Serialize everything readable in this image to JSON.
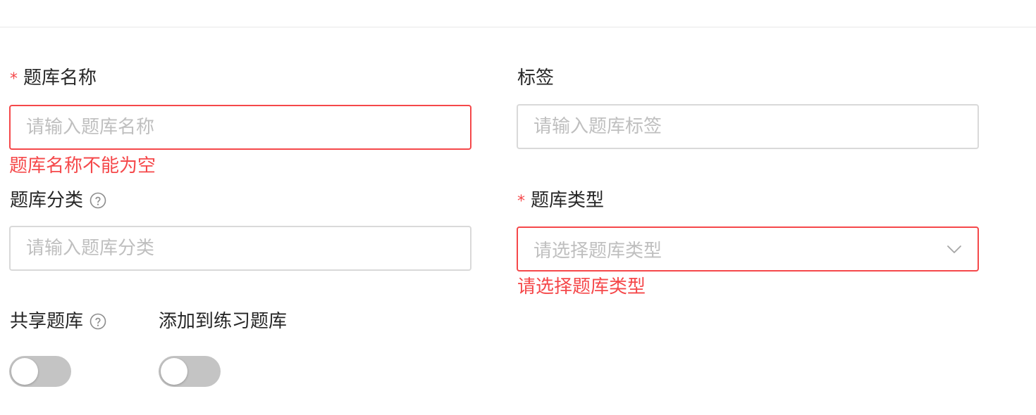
{
  "form": {
    "bank_name": {
      "required_mark": "*",
      "label": "题库名称",
      "placeholder": "请输入题库名称",
      "value": "",
      "error": "题库名称不能为空"
    },
    "tags": {
      "label": "标签",
      "placeholder": "请输入题库标签",
      "value": ""
    },
    "category": {
      "label": "题库分类",
      "placeholder": "请输入题库分类",
      "value": "",
      "help_icon": "question-circle-icon"
    },
    "bank_type": {
      "required_mark": "*",
      "label": "题库类型",
      "placeholder": "请选择题库类型",
      "error": "请选择题库类型",
      "dropdown_icon": "chevron-down-icon"
    },
    "share": {
      "label": "共享题库",
      "help_icon": "question-circle-icon",
      "enabled": false
    },
    "add_to_practice": {
      "label": "添加到练习题库",
      "enabled": false
    }
  },
  "colors": {
    "error": "#f5484a",
    "border": "#d9d9d9",
    "placeholder": "#bfbfbf",
    "switch_off": "#c4c4c4"
  }
}
